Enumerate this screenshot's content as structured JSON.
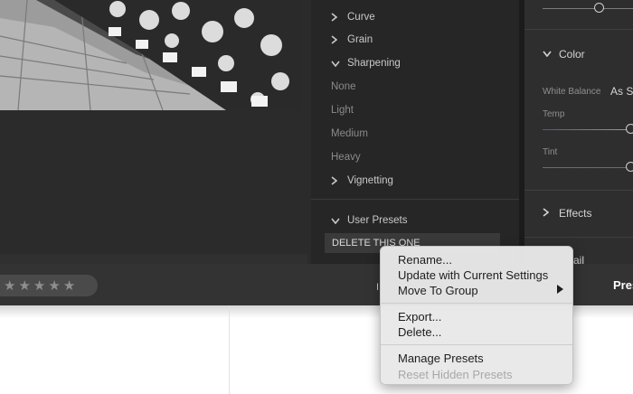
{
  "presets_panel": {
    "groups": [
      {
        "label": "Curve",
        "expanded": false
      },
      {
        "label": "Grain",
        "expanded": false
      },
      {
        "label": "Sharpening",
        "expanded": true
      }
    ],
    "sharpening_items": [
      "None",
      "Light",
      "Medium",
      "Heavy"
    ],
    "vignetting_label": "Vignetting",
    "user_presets_label": "User Presets",
    "user_preset_item": "DELETE THIS ONE"
  },
  "right_panel": {
    "color_header": "Color",
    "white_balance_label": "White Balance",
    "white_balance_value": "As Sh",
    "temp_label": "Temp",
    "tint_label": "Tint",
    "effects_header": "Effects",
    "detail_header_partial": "ail"
  },
  "bottom_bar": {
    "stars": [
      "★",
      "★",
      "★",
      "★",
      "★"
    ],
    "presets_label": "Presets",
    "left_label_partial": "I"
  },
  "context_menu": {
    "items": [
      {
        "label": "Rename...",
        "enabled": true
      },
      {
        "label": "Update with Current Settings",
        "enabled": true
      },
      {
        "label": "Move To Group",
        "enabled": true,
        "has_submenu": true
      },
      {
        "label": "Export...",
        "enabled": true
      },
      {
        "label": "Delete...",
        "enabled": true
      },
      {
        "label": "Manage Presets",
        "enabled": true
      },
      {
        "label": "Reset Hidden Presets",
        "enabled": false
      }
    ]
  },
  "icons": {
    "chevron_right": "chevron-right-icon",
    "chevron_down": "chevron-down-icon",
    "star": "star-icon",
    "submenu": "submenu-arrow-icon"
  },
  "colors": {
    "panel_bg": "#262626",
    "menu_bg": "#e8e8e8",
    "disabled_text": "#a8a8a8"
  }
}
